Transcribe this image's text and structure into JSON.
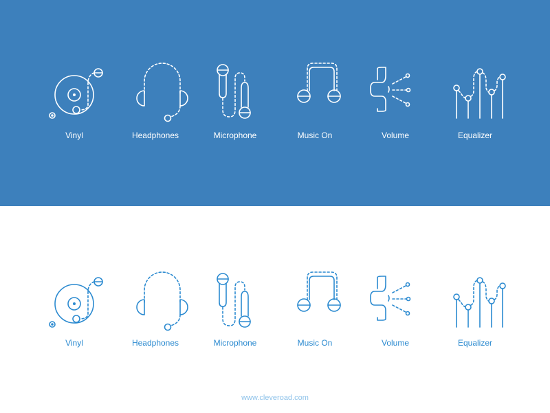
{
  "colors": {
    "panel_background": "#3d80bc",
    "icon_on_blue": "#ffffff",
    "icon_on_white": "#2b8ad0",
    "footer_text": "#8fc3ea"
  },
  "icon_sets": [
    {
      "variant": "white-on-blue",
      "items": [
        {
          "icon": "vinyl-icon",
          "label": "Vinyl"
        },
        {
          "icon": "headphones-icon",
          "label": "Headphones"
        },
        {
          "icon": "microphone-icon",
          "label": "Microphone"
        },
        {
          "icon": "music-on-icon",
          "label": "Music On"
        },
        {
          "icon": "volume-icon",
          "label": "Volume"
        },
        {
          "icon": "equalizer-icon",
          "label": "Equalizer"
        }
      ]
    },
    {
      "variant": "blue-on-white",
      "items": [
        {
          "icon": "vinyl-icon",
          "label": "Vinyl"
        },
        {
          "icon": "headphones-icon",
          "label": "Headphones"
        },
        {
          "icon": "microphone-icon",
          "label": "Microphone"
        },
        {
          "icon": "music-on-icon",
          "label": "Music On"
        },
        {
          "icon": "volume-icon",
          "label": "Volume"
        },
        {
          "icon": "equalizer-icon",
          "label": "Equalizer"
        }
      ]
    }
  ],
  "footer": {
    "url": "www.cleveroad.com"
  }
}
